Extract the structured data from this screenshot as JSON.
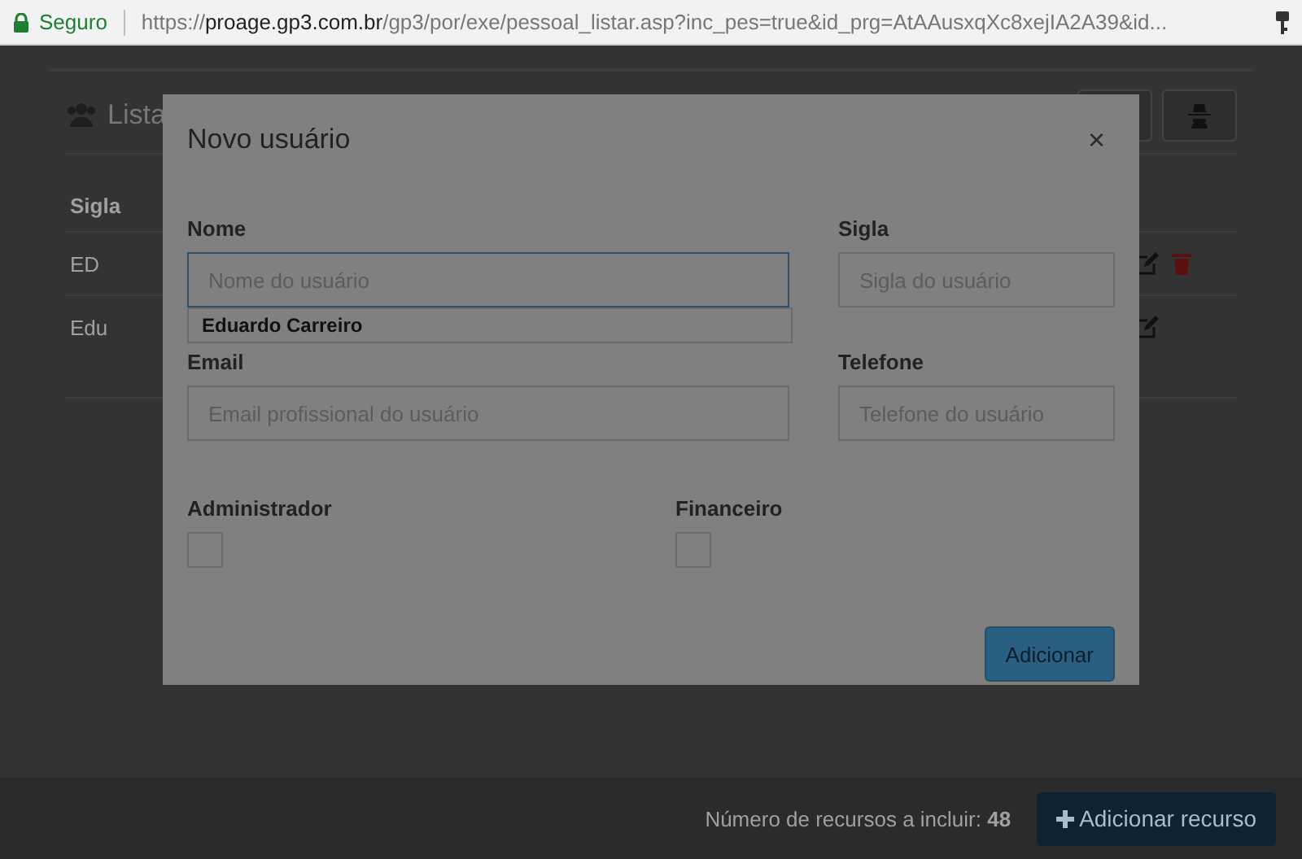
{
  "browser": {
    "security": "Seguro",
    "url": {
      "scheme": "https://",
      "host": "proage.gp3.com.br",
      "path": "/gp3/por/exe/pessoal_listar.asp?inc_pes=true&id_prg=AtAAusxqXc8xejIA2A39&id..."
    }
  },
  "page": {
    "title": "Lista",
    "table": {
      "columns": [
        "Sigla"
      ],
      "rows": [
        {
          "cells": [
            "ED"
          ],
          "deletable": true
        },
        {
          "cells": [
            "Edu"
          ],
          "deletable": false
        }
      ]
    },
    "footer": {
      "count_text": "Número de recursos a incluir: **48**",
      "button": "Adicionar recurso"
    }
  },
  "modal": {
    "title": "Novo usuário",
    "close": "×",
    "fields": [
      {
        "kind": "text",
        "label": "Nome",
        "placeholder": "Nome do usuário",
        "focused": true,
        "suggestions": [
          "Eduardo Carreiro"
        ]
      },
      {
        "kind": "text",
        "label": "Sigla",
        "placeholder": "Sigla do usuário",
        "focused": false
      },
      {
        "kind": "text",
        "label": "Email",
        "placeholder": "Email profissional do usuário",
        "focused": false
      },
      {
        "kind": "text",
        "label": "Telefone",
        "placeholder": "Telefone do usuário",
        "focused": false
      },
      {
        "kind": "checkbox",
        "label": "Administrador",
        "checked": false
      },
      {
        "kind": "checkbox",
        "label": "Financeiro",
        "checked": false
      }
    ],
    "submit": "Adicionar"
  }
}
